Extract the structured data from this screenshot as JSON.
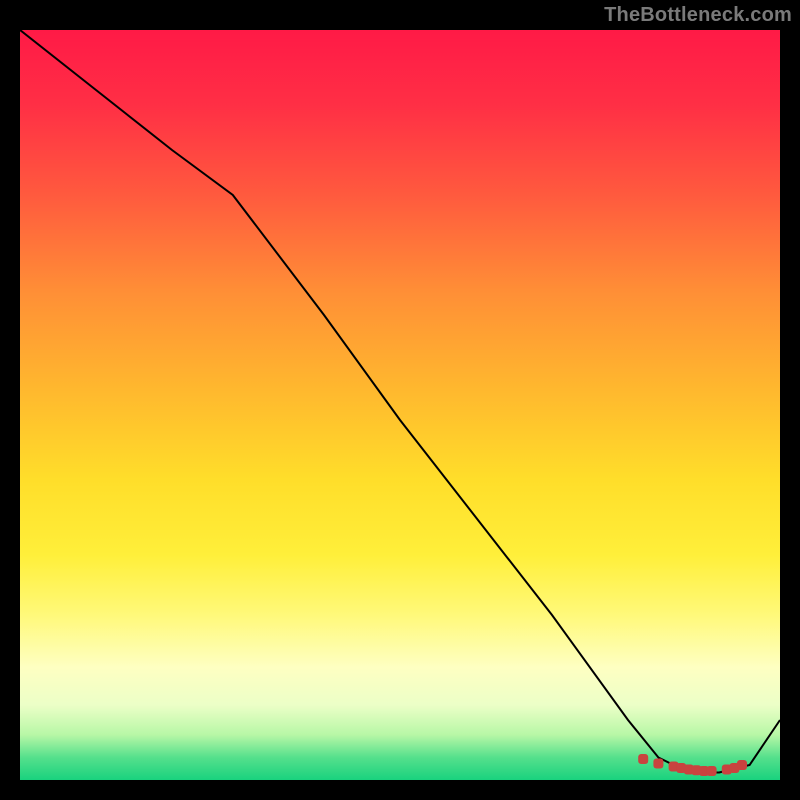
{
  "watermark": "TheBottleneck.com",
  "chart_data": {
    "type": "line",
    "title": "",
    "xlabel": "",
    "ylabel": "",
    "xlim": [
      0,
      100
    ],
    "ylim": [
      0,
      100
    ],
    "grid": false,
    "legend": false,
    "gradient_colors": {
      "top": "#ff1a46",
      "mid_upper": "#ff8f36",
      "mid": "#ffde2a",
      "mid_lower": "#feffc2",
      "bottom": "#19d27e"
    },
    "series": [
      {
        "name": "curve",
        "stroke": "#000000",
        "stroke_width": 2,
        "x": [
          0,
          10,
          20,
          28,
          40,
          50,
          60,
          70,
          80,
          84,
          88,
          92,
          96,
          100
        ],
        "y": [
          100,
          92,
          84,
          78,
          62,
          48,
          35,
          22,
          8,
          3,
          1,
          1,
          2,
          8
        ]
      }
    ],
    "scatter": {
      "name": "highlight-points",
      "color": "#c9433f",
      "marker": "rounded-square",
      "x": [
        82,
        84,
        86,
        87,
        88,
        89,
        90,
        91,
        93,
        94,
        95
      ],
      "y": [
        2.8,
        2.2,
        1.8,
        1.6,
        1.4,
        1.3,
        1.2,
        1.2,
        1.4,
        1.6,
        2.0
      ]
    }
  }
}
